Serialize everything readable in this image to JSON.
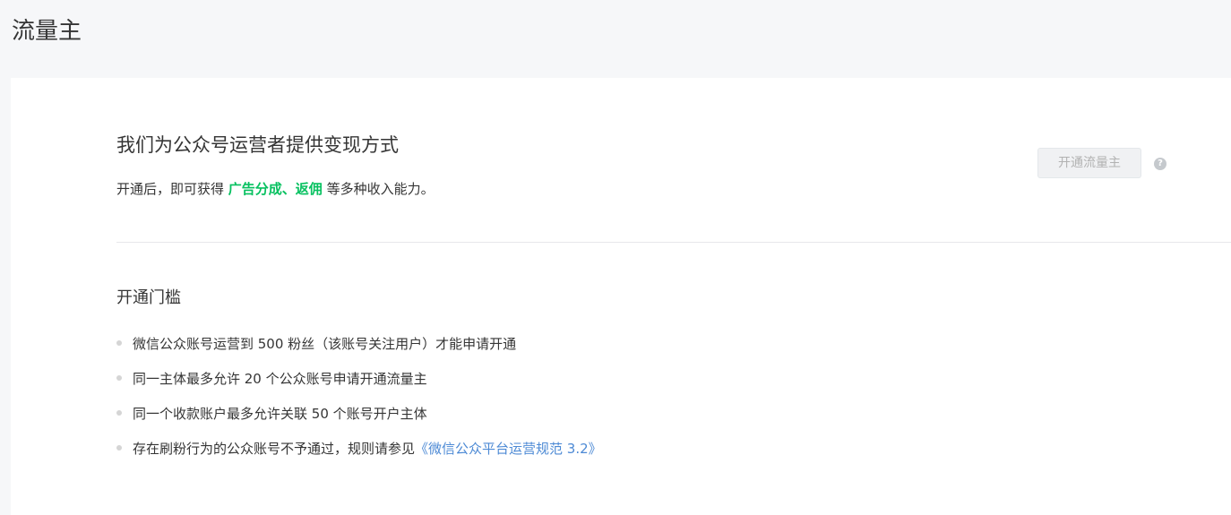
{
  "page": {
    "title": "流量主"
  },
  "intro": {
    "title": "我们为公众号运营者提供变现方式",
    "desc_prefix": "开通后，即可获得 ",
    "desc_highlight": "广告分成、返佣",
    "desc_suffix": " 等多种收入能力。",
    "highlight_color": "#07c160"
  },
  "actions": {
    "open_button_label": "开通流量主",
    "open_button_disabled": true,
    "help_icon": "question-circle-icon",
    "help_glyph": "?"
  },
  "requirements": {
    "title": "开通门槛",
    "items": [
      {
        "text": "微信公众账号运营到 500 粉丝（该账号关注用户）才能申请开通"
      },
      {
        "text": "同一主体最多允许 20 个公众账号申请开通流量主"
      },
      {
        "text": "同一个收款账户最多允许关联 50 个账号开户主体"
      },
      {
        "text": "存在刷粉行为的公众账号不予通过，规则请参见",
        "link": "《微信公众平台运营规范 3.2》"
      }
    ],
    "link_color": "#4d8ad5"
  }
}
